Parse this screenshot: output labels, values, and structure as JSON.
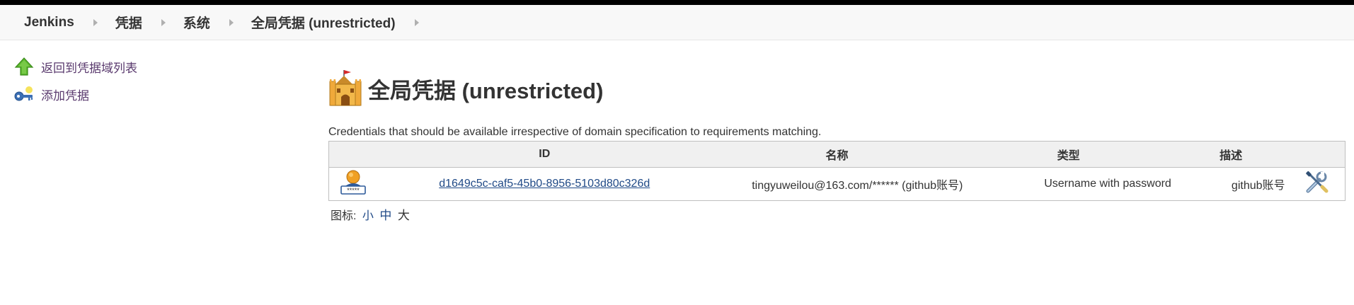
{
  "breadcrumbs": [
    {
      "label": "Jenkins"
    },
    {
      "label": "凭据"
    },
    {
      "label": "系统"
    },
    {
      "label": "全局凭据 (unrestricted)"
    }
  ],
  "sidebar": {
    "items": [
      {
        "label": "返回到凭据域列表",
        "icon": "up-arrow-icon"
      },
      {
        "label": "添加凭据",
        "icon": "key-add-icon"
      }
    ]
  },
  "main": {
    "title": "全局凭据 (unrestricted)",
    "title_icon": "castle-icon",
    "description": "Credentials that should be available irrespective of domain specification to requirements matching.",
    "table": {
      "headers": {
        "id": "ID",
        "name": "名称",
        "type": "类型",
        "desc": "描述"
      },
      "rows": [
        {
          "icon": "user-password-icon",
          "id": "d1649c5c-caf5-45b0-8956-5103d80c326d",
          "name": "tingyuweilou@163.com/****** (github账号)",
          "type": "Username with password",
          "desc": "github账号",
          "action_icon": "configure-tools-icon"
        }
      ]
    },
    "icon_size": {
      "label": "图标:",
      "small": "小",
      "medium": "中",
      "large": "大"
    }
  },
  "colors": {
    "link": "#204a87",
    "task_link": "#5a3a6e",
    "header_bg": "#f0f0f0",
    "breadcrumb_bg": "#f8f8f8"
  }
}
